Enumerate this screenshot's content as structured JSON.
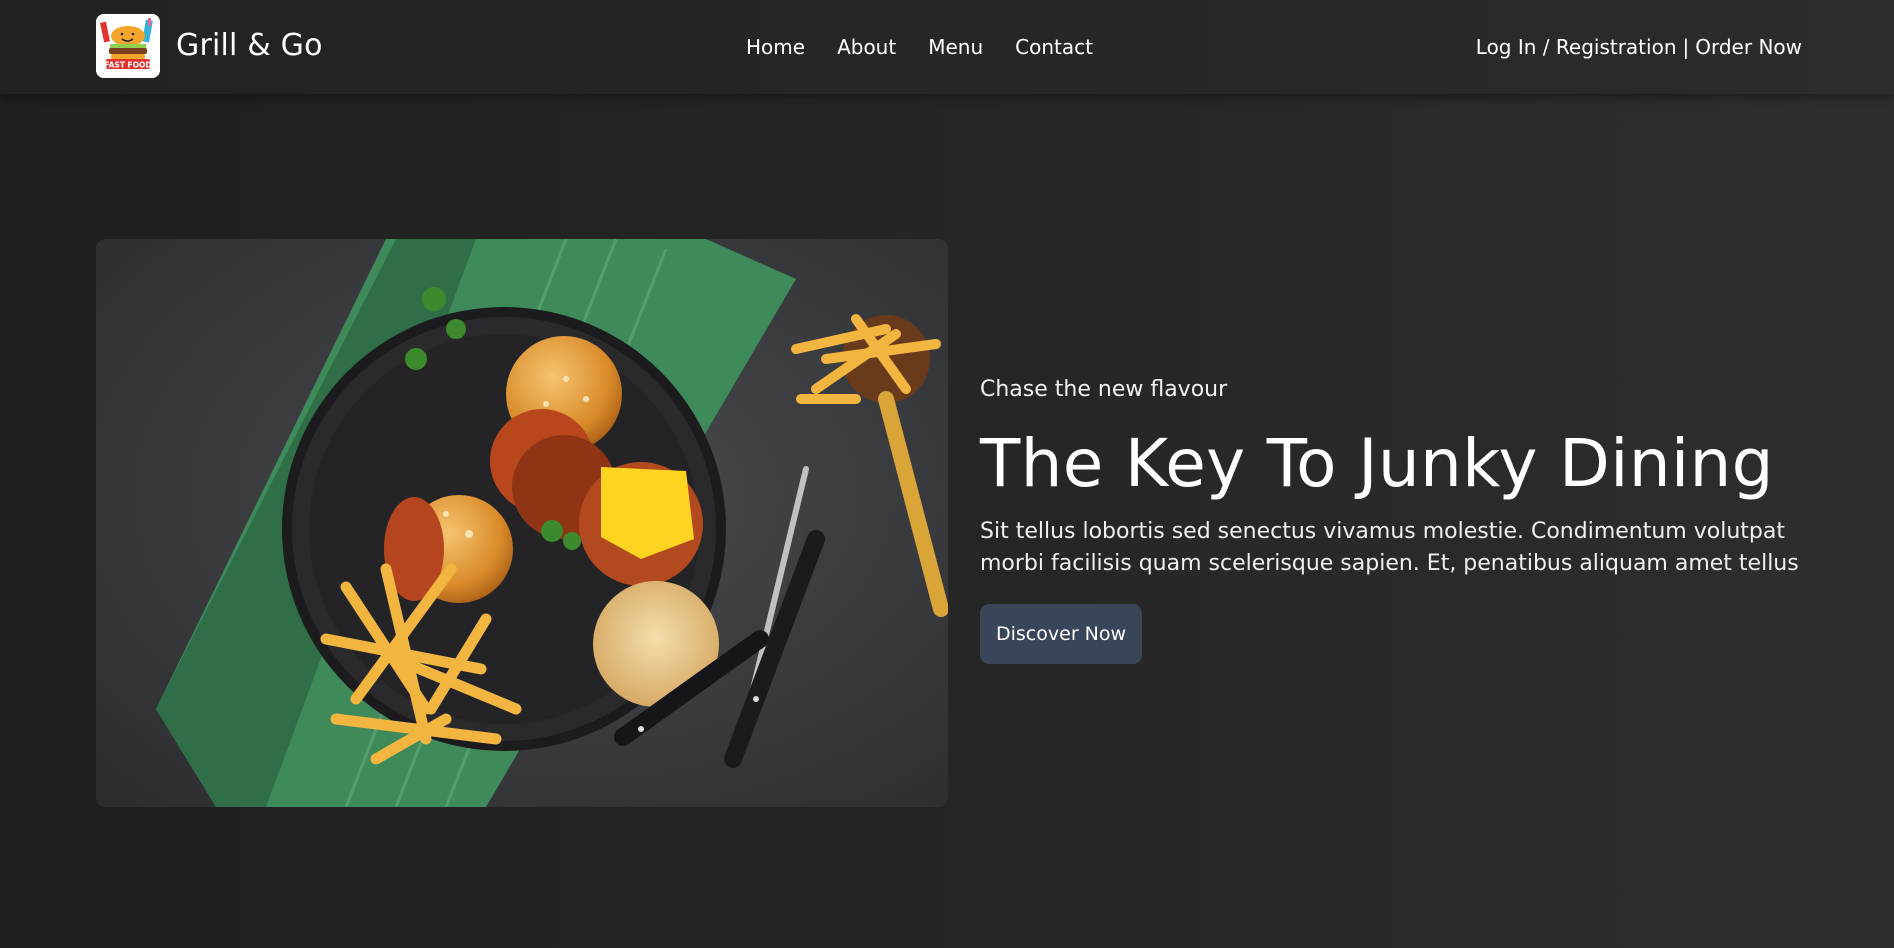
{
  "brand": {
    "name": "Grill & Go",
    "logo_text": "FAST FOOD",
    "logo_icon": "burger-logo-icon"
  },
  "nav": {
    "links": [
      "Home",
      "About",
      "Menu",
      "Contact"
    ],
    "auth_label": "Log In / Registration",
    "separator": "|",
    "order_label": "Order Now"
  },
  "hero": {
    "tagline": "Chase the new flavour",
    "title": "The Key To Junky Dining",
    "description": "Sit tellus lobortis sed senectus vivamus molestie. Condimentum volutpat morbi facilisis quam scelerisque sapien. Et, penatibus aliquam amet tellus",
    "button_label": "Discover Now"
  },
  "colors": {
    "background": "#252525",
    "navbar": "#272727",
    "button": "#39465a",
    "text": "#ffffff"
  }
}
